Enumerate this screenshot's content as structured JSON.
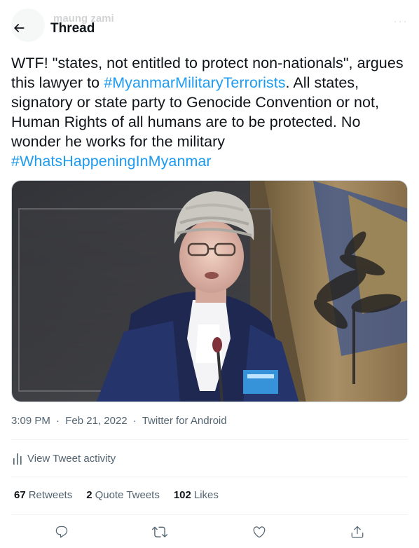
{
  "ghost_author": {
    "name": "maung zami"
  },
  "header": {
    "title": "Thread"
  },
  "tweet": {
    "text_1": "WTF! \"states, not entitled to protect non-nationals\", argues this lawyer to ",
    "hashtag_1": "#MyanmarMilitaryTerrorists",
    "text_2": ". All states, signatory or state party to Genocide Convention or not, Human Rights of all humans are to be protected. No wonder he works for the military ",
    "hashtag_2": "#WhatsHappeningInMyanmar"
  },
  "meta": {
    "time": "3:09 PM",
    "separator": "·",
    "date": "Feb 21, 2022",
    "source": "Twitter for Android"
  },
  "activity": {
    "label": "View Tweet activity"
  },
  "stats": {
    "retweets_count": "67",
    "retweets_label": "Retweets",
    "quotes_count": "2",
    "quotes_label": "Quote Tweets",
    "likes_count": "102",
    "likes_label": "Likes"
  },
  "colors": {
    "link": "#1d9bf0",
    "text": "#0f1419",
    "secondary": "#536471",
    "divider": "#eff3f4"
  },
  "icons": {
    "back": "arrow-left-icon",
    "activity": "bar-chart-icon",
    "reply": "speech-bubble-icon",
    "retweet": "retweet-arrows-icon",
    "like": "heart-icon",
    "share": "share-upload-icon"
  }
}
